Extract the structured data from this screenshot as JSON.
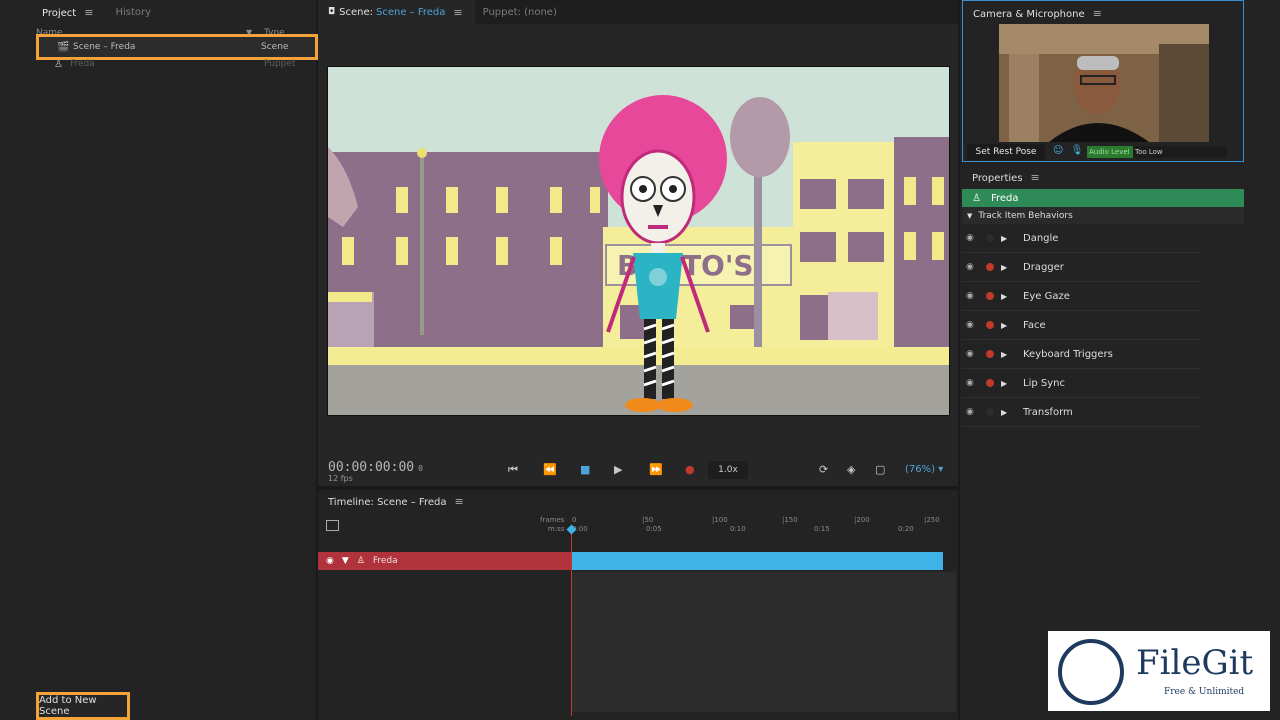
{
  "project": {
    "tabs": [
      "Project",
      "History"
    ],
    "columns": {
      "name": "Name",
      "type": "Type"
    },
    "rows": [
      {
        "name": "Scene – Freda",
        "type": "Scene"
      },
      {
        "name": "Freda",
        "type": "Puppet"
      }
    ],
    "add_button": "Add to New Scene"
  },
  "scene": {
    "tab_prefix": "Scene:",
    "tab_name": "Scene – Freda",
    "puppet_tab": "Puppet: (none)",
    "timecode": "00:00:00:00",
    "frame": "0",
    "fps": "12 fps",
    "rate": "1.0x",
    "zoom": "(76%)",
    "sign_text": "B NITO'S"
  },
  "timeline": {
    "title": "Timeline: Scene – Freda",
    "ruler_frames_label": "frames",
    "ruler_time_label": "m:ss",
    "ticks": [
      {
        "frames": "0",
        "time": "0:00"
      },
      {
        "frames": "|50",
        "time": "0:05"
      },
      {
        "frames": "|100",
        "time": "0:10"
      },
      {
        "frames": "|150",
        "time": "0:15"
      },
      {
        "frames": "|200",
        "time": "0:20"
      },
      {
        "frames": "|250",
        "time": ""
      }
    ],
    "track_name": "Freda"
  },
  "camera": {
    "title": "Camera & Microphone",
    "rest_pose": "Set Rest Pose",
    "audio_level": "Audio Level",
    "audio_msg": "Too Low"
  },
  "properties": {
    "title": "Properties",
    "puppet": "Freda",
    "behaviors_header": "Track Item Behaviors",
    "behaviors": [
      {
        "name": "Dangle",
        "armed": false
      },
      {
        "name": "Dragger",
        "armed": true
      },
      {
        "name": "Eye Gaze",
        "armed": true
      },
      {
        "name": "Face",
        "armed": true
      },
      {
        "name": "Keyboard Triggers",
        "armed": true
      },
      {
        "name": "Lip Sync",
        "armed": true
      },
      {
        "name": "Transform",
        "armed": false
      }
    ]
  },
  "watermark": {
    "title": "FileGit",
    "subtitle": "Free & Unlimited"
  },
  "colors": {
    "accent": "#4fa3d8",
    "highlight": "#f2a43a",
    "track": "#b0323a",
    "bar": "#3fb3e6",
    "puppet": "#2e8b57",
    "record": "#c0392b"
  }
}
